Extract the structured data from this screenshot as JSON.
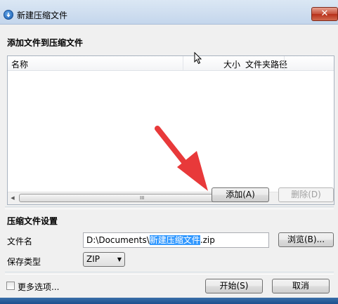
{
  "window": {
    "title": "新建压缩文件",
    "close_label": "✕"
  },
  "add_section": {
    "title": "添加文件到压缩文件",
    "columns": {
      "name": "名称",
      "size": "大小",
      "path": "文件夹路径"
    },
    "grip": "III",
    "add_button": "添加(A)",
    "delete_button": "删除(D)"
  },
  "settings_section": {
    "title": "压缩文件设置",
    "filename_label": "文件名",
    "filename_prefix": "D:\\Documents\\",
    "filename_selected": "新建压缩文件",
    "filename_suffix": ".zip",
    "browse_button": "浏览(B)...",
    "type_label": "保存类型",
    "type_value": "ZIP"
  },
  "footer": {
    "more_options_label": "更多选项...",
    "start_button": "开始(S)",
    "cancel_button": "取消"
  },
  "colors": {
    "accent_arrow": "#e8393a",
    "selection": "#3399ff"
  },
  "icons": {
    "app": "app-icon",
    "cursor": "mouse-cursor-icon",
    "arrow": "red-arrow-annotation"
  }
}
